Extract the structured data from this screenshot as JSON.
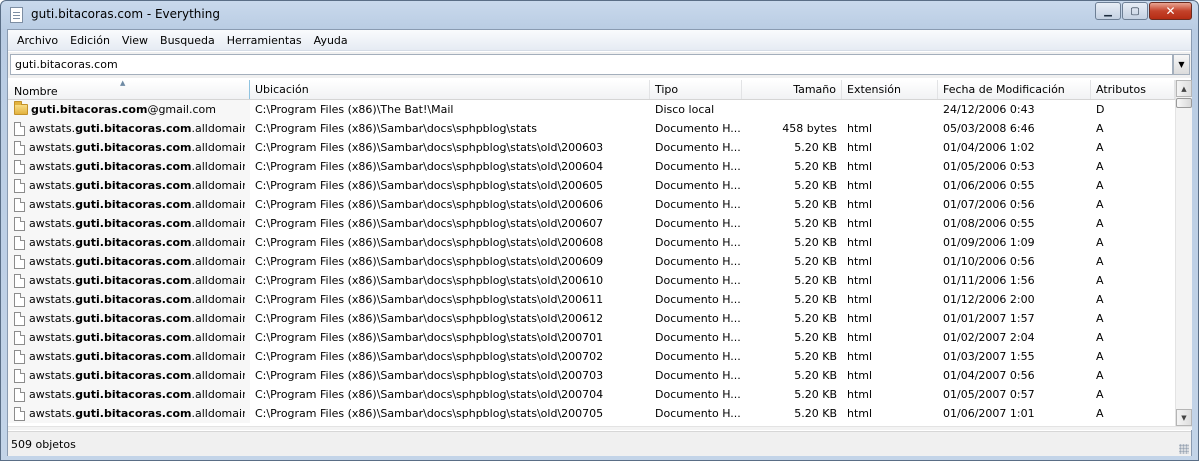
{
  "window": {
    "title": "guti.bitacoras.com - Everything",
    "minimize": "▁",
    "maximize": "▢",
    "close": "✕"
  },
  "menu": [
    "Archivo",
    "Edición",
    "View",
    "Busqueda",
    "Herramientas",
    "Ayuda"
  ],
  "search": {
    "value": "guti.bitacoras.com",
    "dropdown_glyph": "▼"
  },
  "columns": [
    "Nombre",
    "Ubicación",
    "Tipo",
    "Tamaño",
    "Extensión",
    "Fecha de Modificación",
    "Atributos"
  ],
  "sort_indicator": "▲",
  "rows": [
    {
      "icon": "folder",
      "name_pre": "",
      "name_bold": "guti.bitacoras.com",
      "name_post": "@gmail.com",
      "location": "C:\\Program Files (x86)\\The Bat!\\Mail",
      "type": "Disco local",
      "size": "",
      "ext": "",
      "date": "24/12/2006 0:43",
      "attr": "D"
    },
    {
      "icon": "file",
      "name_pre": "awstats.",
      "name_bold": "guti.bitacoras.com",
      "name_post": ".alldomains....",
      "location": "C:\\Program Files (x86)\\Sambar\\docs\\sphpblog\\stats",
      "type": "Documento H...",
      "size": "458 bytes",
      "ext": "html",
      "date": "05/03/2008 6:46",
      "attr": "A"
    },
    {
      "icon": "file",
      "name_pre": "awstats.",
      "name_bold": "guti.bitacoras.com",
      "name_post": ".alldomains....",
      "location": "C:\\Program Files (x86)\\Sambar\\docs\\sphpblog\\stats\\old\\200603",
      "type": "Documento H...",
      "size": "5.20 KB",
      "ext": "html",
      "date": "01/04/2006 1:02",
      "attr": "A"
    },
    {
      "icon": "file",
      "name_pre": "awstats.",
      "name_bold": "guti.bitacoras.com",
      "name_post": ".alldomains....",
      "location": "C:\\Program Files (x86)\\Sambar\\docs\\sphpblog\\stats\\old\\200604",
      "type": "Documento H...",
      "size": "5.20 KB",
      "ext": "html",
      "date": "01/05/2006 0:53",
      "attr": "A"
    },
    {
      "icon": "file",
      "name_pre": "awstats.",
      "name_bold": "guti.bitacoras.com",
      "name_post": ".alldomains....",
      "location": "C:\\Program Files (x86)\\Sambar\\docs\\sphpblog\\stats\\old\\200605",
      "type": "Documento H...",
      "size": "5.20 KB",
      "ext": "html",
      "date": "01/06/2006 0:55",
      "attr": "A"
    },
    {
      "icon": "file",
      "name_pre": "awstats.",
      "name_bold": "guti.bitacoras.com",
      "name_post": ".alldomains....",
      "location": "C:\\Program Files (x86)\\Sambar\\docs\\sphpblog\\stats\\old\\200606",
      "type": "Documento H...",
      "size": "5.20 KB",
      "ext": "html",
      "date": "01/07/2006 0:56",
      "attr": "A"
    },
    {
      "icon": "file",
      "name_pre": "awstats.",
      "name_bold": "guti.bitacoras.com",
      "name_post": ".alldomains....",
      "location": "C:\\Program Files (x86)\\Sambar\\docs\\sphpblog\\stats\\old\\200607",
      "type": "Documento H...",
      "size": "5.20 KB",
      "ext": "html",
      "date": "01/08/2006 0:55",
      "attr": "A"
    },
    {
      "icon": "file",
      "name_pre": "awstats.",
      "name_bold": "guti.bitacoras.com",
      "name_post": ".alldomains....",
      "location": "C:\\Program Files (x86)\\Sambar\\docs\\sphpblog\\stats\\old\\200608",
      "type": "Documento H...",
      "size": "5.20 KB",
      "ext": "html",
      "date": "01/09/2006 1:09",
      "attr": "A"
    },
    {
      "icon": "file",
      "name_pre": "awstats.",
      "name_bold": "guti.bitacoras.com",
      "name_post": ".alldomains....",
      "location": "C:\\Program Files (x86)\\Sambar\\docs\\sphpblog\\stats\\old\\200609",
      "type": "Documento H...",
      "size": "5.20 KB",
      "ext": "html",
      "date": "01/10/2006 0:56",
      "attr": "A"
    },
    {
      "icon": "file",
      "name_pre": "awstats.",
      "name_bold": "guti.bitacoras.com",
      "name_post": ".alldomains....",
      "location": "C:\\Program Files (x86)\\Sambar\\docs\\sphpblog\\stats\\old\\200610",
      "type": "Documento H...",
      "size": "5.20 KB",
      "ext": "html",
      "date": "01/11/2006 1:56",
      "attr": "A"
    },
    {
      "icon": "file",
      "name_pre": "awstats.",
      "name_bold": "guti.bitacoras.com",
      "name_post": ".alldomains....",
      "location": "C:\\Program Files (x86)\\Sambar\\docs\\sphpblog\\stats\\old\\200611",
      "type": "Documento H...",
      "size": "5.20 KB",
      "ext": "html",
      "date": "01/12/2006 2:00",
      "attr": "A"
    },
    {
      "icon": "file",
      "name_pre": "awstats.",
      "name_bold": "guti.bitacoras.com",
      "name_post": ".alldomains....",
      "location": "C:\\Program Files (x86)\\Sambar\\docs\\sphpblog\\stats\\old\\200612",
      "type": "Documento H...",
      "size": "5.20 KB",
      "ext": "html",
      "date": "01/01/2007 1:57",
      "attr": "A"
    },
    {
      "icon": "file",
      "name_pre": "awstats.",
      "name_bold": "guti.bitacoras.com",
      "name_post": ".alldomains....",
      "location": "C:\\Program Files (x86)\\Sambar\\docs\\sphpblog\\stats\\old\\200701",
      "type": "Documento H...",
      "size": "5.20 KB",
      "ext": "html",
      "date": "01/02/2007 2:04",
      "attr": "A"
    },
    {
      "icon": "file",
      "name_pre": "awstats.",
      "name_bold": "guti.bitacoras.com",
      "name_post": ".alldomains....",
      "location": "C:\\Program Files (x86)\\Sambar\\docs\\sphpblog\\stats\\old\\200702",
      "type": "Documento H...",
      "size": "5.20 KB",
      "ext": "html",
      "date": "01/03/2007 1:55",
      "attr": "A"
    },
    {
      "icon": "file",
      "name_pre": "awstats.",
      "name_bold": "guti.bitacoras.com",
      "name_post": ".alldomains....",
      "location": "C:\\Program Files (x86)\\Sambar\\docs\\sphpblog\\stats\\old\\200703",
      "type": "Documento H...",
      "size": "5.20 KB",
      "ext": "html",
      "date": "01/04/2007 0:56",
      "attr": "A"
    },
    {
      "icon": "file",
      "name_pre": "awstats.",
      "name_bold": "guti.bitacoras.com",
      "name_post": ".alldomains....",
      "location": "C:\\Program Files (x86)\\Sambar\\docs\\sphpblog\\stats\\old\\200704",
      "type": "Documento H...",
      "size": "5.20 KB",
      "ext": "html",
      "date": "01/05/2007 0:57",
      "attr": "A"
    },
    {
      "icon": "file",
      "name_pre": "awstats.",
      "name_bold": "guti.bitacoras.com",
      "name_post": ".alldomains....",
      "location": "C:\\Program Files (x86)\\Sambar\\docs\\sphpblog\\stats\\old\\200705",
      "type": "Documento H...",
      "size": "5.20 KB",
      "ext": "html",
      "date": "01/06/2007 1:01",
      "attr": "A"
    }
  ],
  "scrollbar": {
    "up": "▲",
    "down": "▼"
  },
  "status": {
    "count": "509 objetos"
  }
}
